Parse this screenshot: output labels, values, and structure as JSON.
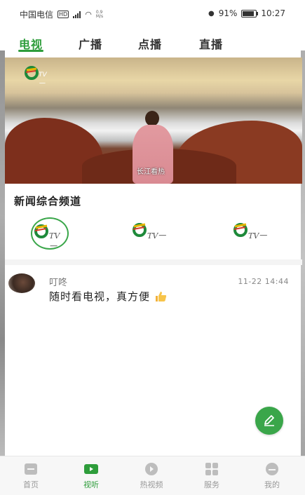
{
  "status_bar": {
    "carrier": "中国电信",
    "speed_top": "0.9",
    "speed_unit": "M/s",
    "battery": "91%",
    "time": "10:27"
  },
  "tabs": [
    {
      "label": "电视",
      "active": true
    },
    {
      "label": "广播",
      "active": false
    },
    {
      "label": "点播",
      "active": false
    },
    {
      "label": "直播",
      "active": false
    }
  ],
  "banner": {
    "logo_text": "TV一",
    "caption": "长江看热"
  },
  "channel_section": {
    "title": "新闻综合频道",
    "channels": [
      {
        "logo_text": "TV一",
        "selected": true
      },
      {
        "logo_text": "TV一",
        "selected": false
      },
      {
        "logo_text": "TV一",
        "selected": false
      }
    ]
  },
  "comment": {
    "user": "叮咚",
    "time": "11-22 14:44",
    "text": "随时看电视，真方便"
  },
  "bottom_nav": [
    {
      "label": "首页",
      "icon": "home-icon",
      "active": false
    },
    {
      "label": "视听",
      "icon": "video-icon",
      "active": true
    },
    {
      "label": "热视频",
      "icon": "play-icon",
      "active": false
    },
    {
      "label": "服务",
      "icon": "grid-icon",
      "active": false
    },
    {
      "label": "我的",
      "icon": "user-icon",
      "active": false
    }
  ],
  "colors": {
    "accent": "#2e9d3b",
    "inactive": "#999999"
  }
}
